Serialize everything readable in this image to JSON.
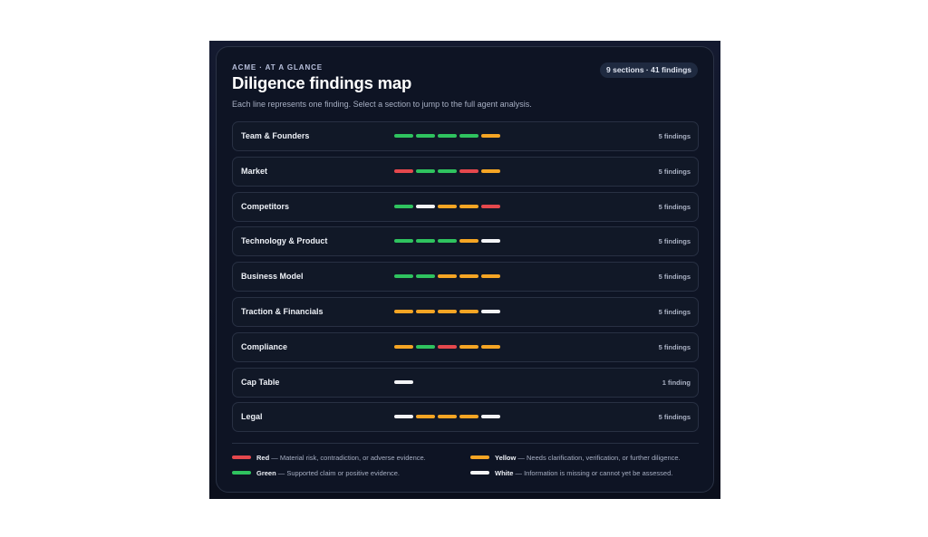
{
  "colors": {
    "red": "#e5484d",
    "green": "#2fc35f",
    "yellow": "#f5a524",
    "white": "#f3f4f6"
  },
  "header": {
    "eyebrow": "ACME · AT A GLANCE",
    "title": "Diligence findings map",
    "badge": "9 sections · 41 findings",
    "subtitle": "Each line represents one finding. Select a section to jump to the full agent analysis."
  },
  "sections": [
    {
      "name": "Team & Founders",
      "count": "5 findings",
      "findings": [
        "green",
        "green",
        "green",
        "green",
        "yellow"
      ]
    },
    {
      "name": "Market",
      "count": "5 findings",
      "findings": [
        "red",
        "green",
        "green",
        "red",
        "yellow"
      ]
    },
    {
      "name": "Competitors",
      "count": "5 findings",
      "findings": [
        "green",
        "white",
        "yellow",
        "yellow",
        "red"
      ]
    },
    {
      "name": "Technology & Product",
      "count": "5 findings",
      "findings": [
        "green",
        "green",
        "green",
        "yellow",
        "white"
      ]
    },
    {
      "name": "Business Model",
      "count": "5 findings",
      "findings": [
        "green",
        "green",
        "yellow",
        "yellow",
        "yellow"
      ]
    },
    {
      "name": "Traction & Financials",
      "count": "5 findings",
      "findings": [
        "yellow",
        "yellow",
        "yellow",
        "yellow",
        "white"
      ]
    },
    {
      "name": "Compliance",
      "count": "5 findings",
      "findings": [
        "yellow",
        "green",
        "red",
        "yellow",
        "yellow"
      ]
    },
    {
      "name": "Cap Table",
      "count": "1 finding",
      "findings": [
        "white"
      ]
    },
    {
      "name": "Legal",
      "count": "5 findings",
      "findings": [
        "white",
        "yellow",
        "yellow",
        "yellow",
        "white"
      ]
    }
  ],
  "legend": {
    "red": {
      "name": "Red",
      "desc": " — Material risk, contradiction, or adverse evidence."
    },
    "yellow": {
      "name": "Yellow",
      "desc": " — Needs clarification, verification, or further diligence."
    },
    "green": {
      "name": "Green",
      "desc": " — Supported claim or positive evidence."
    },
    "white": {
      "name": "White",
      "desc": " — Information is missing or cannot yet be assessed."
    }
  }
}
